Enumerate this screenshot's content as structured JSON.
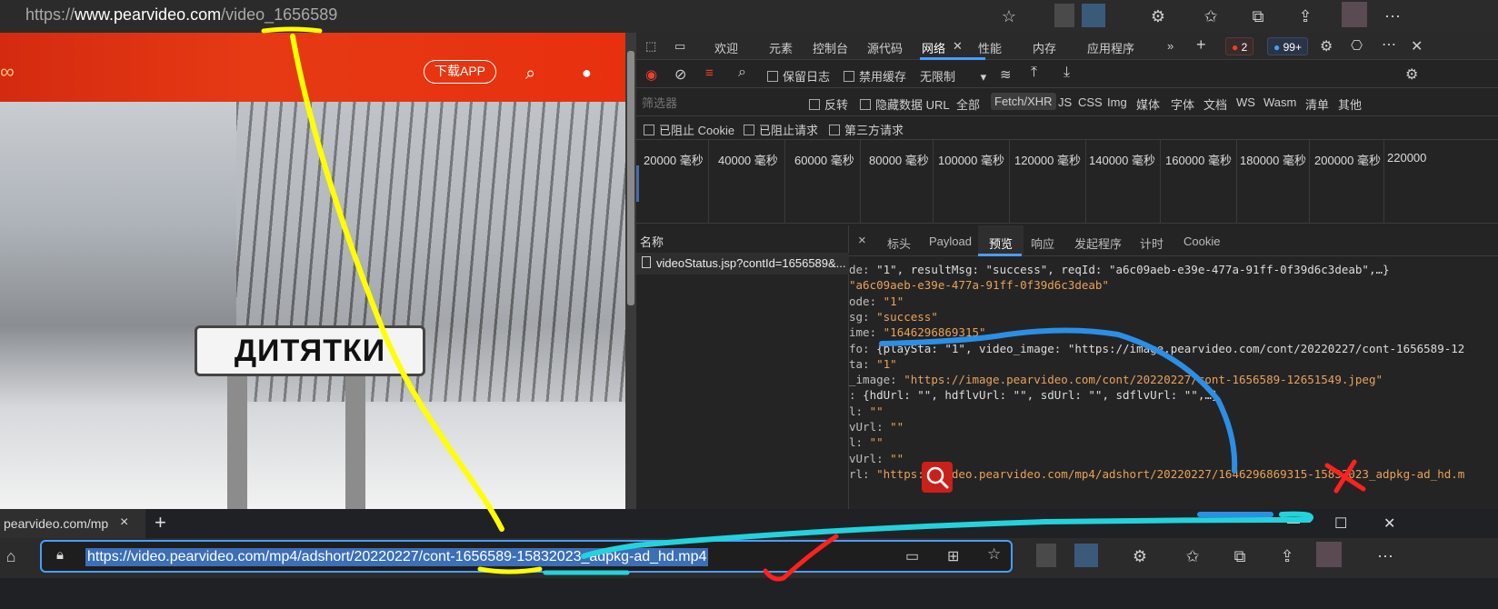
{
  "top_bar": {
    "url_prefix": "https://",
    "url_host": "www.pearvideo.com",
    "url_path": "/video_1656589"
  },
  "site": {
    "download_label": "下载APP",
    "sign_text": "ДИТЯТКИ"
  },
  "devtools": {
    "tabs": [
      "欢迎",
      "元素",
      "控制台",
      "源代码",
      "网络",
      "性能",
      "内存",
      "应用程序"
    ],
    "active_tab": "网络",
    "more_tabs": "»",
    "error_count": "2",
    "message_count": "99+",
    "toolbar": {
      "preserve_log": "保留日志",
      "disable_cache": "禁用缓存",
      "throttle": "无限制"
    },
    "filter": {
      "placeholder": "筛选器",
      "invert": "反转",
      "hide_data_url": "隐藏数据 URL",
      "types": [
        "全部",
        "Fetch/XHR",
        "JS",
        "CSS",
        "Img",
        "媒体",
        "字体",
        "文档",
        "WS",
        "Wasm",
        "清单",
        "其他"
      ],
      "active_type": "Fetch/XHR"
    },
    "cookie_filters": [
      "已阻止 Cookie",
      "已阻止请求",
      "第三方请求"
    ],
    "timeline_ticks": [
      "20000 毫秒",
      "40000 毫秒",
      "60000 毫秒",
      "80000 毫秒",
      "100000 毫秒",
      "120000 毫秒",
      "140000 毫秒",
      "160000 毫秒",
      "180000 毫秒",
      "200000 毫秒",
      "220000"
    ],
    "names_header": "名称",
    "request_name": "videoStatus.jsp?contId=1656589&...",
    "detail_close": "×",
    "detail_tabs": [
      "标头",
      "Payload",
      "预览",
      "响应",
      "发起程序",
      "计时",
      "Cookie"
    ],
    "active_detail_tab": "预览",
    "preview_lines": [
      {
        "k": "de: ",
        "v": "\"1\", resultMsg: \"success\", reqId: \"a6c09aeb-e39e-477a-91ff-0f39d6c3deab\",…}",
        "str": false
      },
      {
        "k": "",
        "v": "\"a6c09aeb-e39e-477a-91ff-0f39d6c3deab\"",
        "str": true
      },
      {
        "k": "ode: ",
        "v": "\"1\"",
        "str": true
      },
      {
        "k": "sg: ",
        "v": "\"success\"",
        "str": true
      },
      {
        "k": "ime: ",
        "v": "\"1646296869315\"",
        "str": true
      },
      {
        "k": "fo: ",
        "v": "{playSta: \"1\", video_image: \"https://image.pearvideo.com/cont/20220227/cont-1656589-12",
        "str": false
      },
      {
        "k": "ta: ",
        "v": "\"1\"",
        "str": true
      },
      {
        "k": "_image: ",
        "v": "\"https://image.pearvideo.com/cont/20220227/cont-1656589-12651549.jpeg\"",
        "str": true
      },
      {
        "k": ": ",
        "v": "{hdUrl: \"\", hdflvUrl: \"\", sdUrl: \"\", sdflvUrl: \"\",…}",
        "str": false
      },
      {
        "k": "l: ",
        "v": "\"\"",
        "str": true
      },
      {
        "k": "vUrl: ",
        "v": "\"\"",
        "str": true
      },
      {
        "k": "l: ",
        "v": "\"\"",
        "str": true
      },
      {
        "k": "vUrl: ",
        "v": "\"\"",
        "str": true
      },
      {
        "k": "rl: ",
        "v": "\"https://video.pearvideo.com/mp4/adshort/20220227/1646296869315-15832023_adpkg-ad_hd.m",
        "str": true
      }
    ]
  },
  "bottom_browser": {
    "tab_label": "pearvideo.com/mp",
    "tab_close": "×",
    "new_tab": "+",
    "address": "https://video.pearvideo.com/mp4/adshort/20220227/cont-1656589-15832023_adpkg-ad_hd.mp4",
    "window_minimize": "—",
    "window_maximize": "☐",
    "window_close": "✕"
  },
  "colors": {
    "accent": "#4a9df8",
    "banner_red": "#e63a14",
    "error_red": "#e8412c",
    "annotation_yellow": "#ffff00",
    "annotation_blue": "#2b8fe6",
    "annotation_cyan": "#22d3dd",
    "annotation_red": "#ff2020"
  }
}
